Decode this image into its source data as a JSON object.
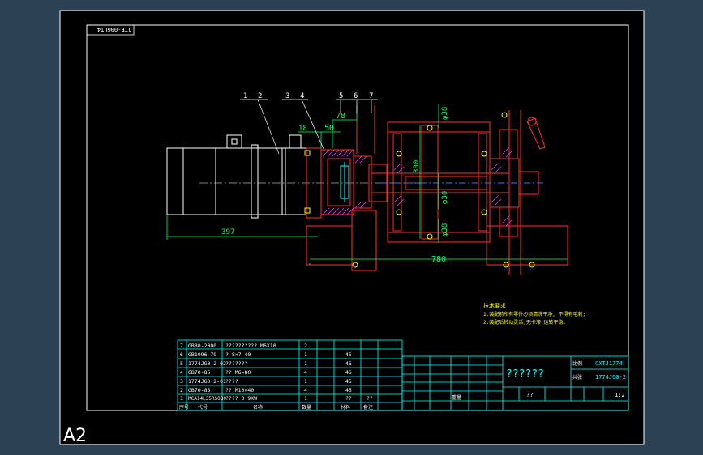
{
  "drawing": {
    "sheet_size": "A2",
    "stamp_text": "1TE-00GLT4",
    "colors": {
      "background": "#2c4254",
      "paper": "#000000",
      "frame": "#ffffff",
      "geometry": "#ff3030",
      "dimension": "#00ff66",
      "hatch": "#ff3cff",
      "leader": "#ffff00",
      "table": "#00ffff",
      "motor": "#ffffff",
      "center": "#4a6bff"
    }
  },
  "dimensions": {
    "d397": "397",
    "d780": "780",
    "d18": "18",
    "d50": "50",
    "d78": "78",
    "d300": "300",
    "phi38_top": "φ38",
    "phi30": "φ30",
    "phi38_bottom": "φ38"
  },
  "callouts": [
    "1",
    "2",
    "3",
    "4",
    "5",
    "6",
    "7"
  ],
  "notes": {
    "title": "技术要求",
    "line1": "1.装配前所有零件必须清洗干净, 不得有毛刺;",
    "line2": "2.装配后转动灵活,无卡滞,运转平稳。"
  },
  "bom": {
    "rows": [
      {
        "no": "7",
        "code": "GB80-2000",
        "name": "?????????? M6X10",
        "qty": "2",
        "material": "",
        "weight": ""
      },
      {
        "no": "6",
        "code": "GB1096-79",
        "name": "? 8×7-40",
        "qty": "1",
        "material": "45",
        "weight": ""
      },
      {
        "no": "5",
        "code": "1774JG0-2-02",
        "name": "???????",
        "qty": "1",
        "material": "45",
        "weight": ""
      },
      {
        "no": "4",
        "code": "GB70-85",
        "name": "?? M6×80",
        "qty": "4",
        "material": "45",
        "weight": ""
      },
      {
        "no": "3",
        "code": "1774JG0-2-01",
        "name": "????",
        "qty": "1",
        "material": "45",
        "weight": ""
      },
      {
        "no": "2",
        "code": "GB70-85",
        "name": "?? M10×40",
        "qty": "4",
        "material": "45",
        "weight": ""
      },
      {
        "no": "1",
        "code": "MCA14L35RS0B0",
        "name": "???? 3.9KW",
        "qty": "1",
        "material": "??",
        "weight": "??"
      }
    ],
    "header": {
      "no": "序号",
      "code": "代号",
      "name": "名称",
      "qty": "数量",
      "material": "材料",
      "weight": "备注"
    }
  },
  "title_block": {
    "title": "??????",
    "drawing_no": "CXTJ1774",
    "part_no": "1774JG0-2",
    "label_scale": "比例",
    "label_sheet": "共张",
    "qty_mark": "??",
    "scale_value": "1:2",
    "label_mass": "重量"
  }
}
